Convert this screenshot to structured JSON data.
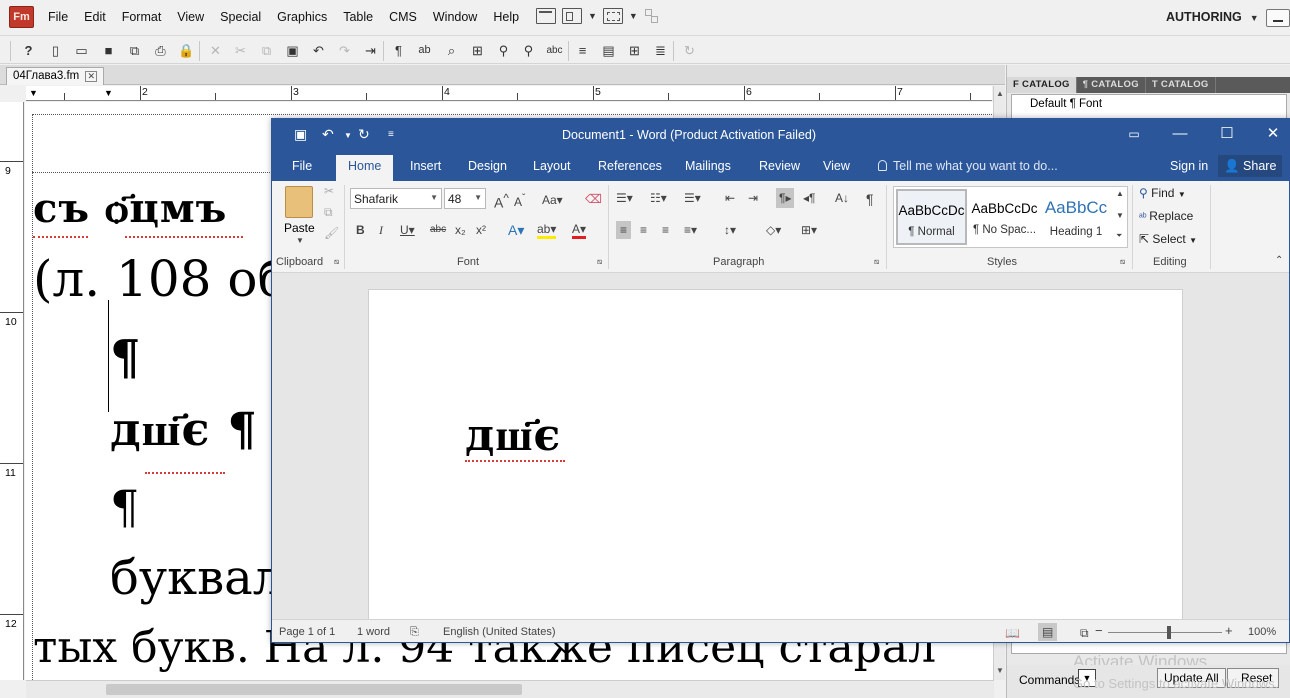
{
  "fm": {
    "logo": "Fm",
    "menus": [
      "File",
      "Edit",
      "Format",
      "View",
      "Special",
      "Graphics",
      "Table",
      "CMS",
      "Window",
      "Help"
    ],
    "workspace": "AUTHORING",
    "doc_tab": "04Глава3.fm",
    "ruler_h": [
      "2",
      "3",
      "4",
      "5",
      "6",
      "7"
    ],
    "ruler_v": [
      "9",
      "10",
      "11",
      "12"
    ],
    "doc_lines": {
      "l1": "съ   ѻ҃цмъ",
      "l2": "(л. 108 об",
      "l3": "¶",
      "l4": "дш҃є ¶",
      "l5": "¶",
      "l6": "буквал",
      "l7": "тых букв. На л. 94 также писец старал"
    }
  },
  "catalog": {
    "tabs": [
      "F CATALOG",
      "¶ CATALOG",
      "T CATALOG"
    ],
    "item": "Default ¶ Font",
    "commands_label": "Commands:",
    "update_all": "Update All",
    "reset": "Reset",
    "watermark_1": "Activate Windows",
    "watermark_2": "Go to Settings to activate Windows."
  },
  "word": {
    "title": "Document1 - Word (Product Activation Failed)",
    "tabs": [
      "File",
      "Home",
      "Insert",
      "Design",
      "Layout",
      "References",
      "Mailings",
      "Review",
      "View"
    ],
    "tell_me": "Tell me what you want to do...",
    "sign_in": "Sign in",
    "share": "Share",
    "clipboard": {
      "paste": "Paste",
      "label": "Clipboard"
    },
    "font": {
      "name": "Shafarik",
      "size": "48",
      "label": "Font"
    },
    "paragraph_label": "Paragraph",
    "styles": {
      "label": "Styles",
      "items": [
        {
          "preview": "AaBbCcDc",
          "name": "¶ Normal"
        },
        {
          "preview": "AaBbCcDc",
          "name": "¶ No Spac..."
        },
        {
          "preview": "AaBbCc",
          "name": "Heading 1"
        }
      ]
    },
    "editing": {
      "find": "Find",
      "replace": "Replace",
      "select": "Select",
      "label": "Editing"
    },
    "document_text": "дш҃є",
    "status": {
      "page": "Page 1 of 1",
      "words": "1 word",
      "language": "English (United States)",
      "zoom": "100%"
    }
  }
}
